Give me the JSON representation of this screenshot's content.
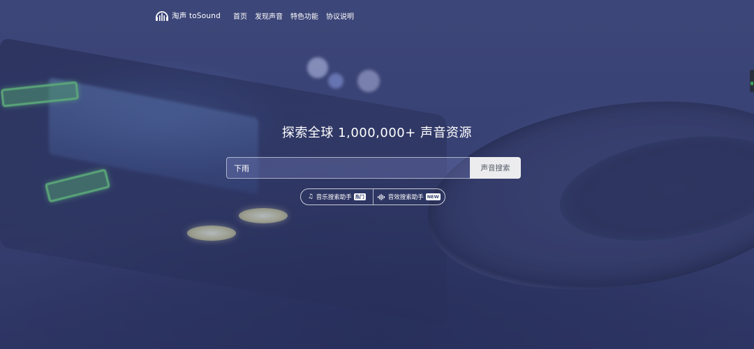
{
  "header": {
    "logo_text": "淘声 toSound",
    "nav": [
      {
        "label": "首页"
      },
      {
        "label": "发现声音"
      },
      {
        "label": "特色功能"
      },
      {
        "label": "协议说明"
      }
    ]
  },
  "hero": {
    "title": "探索全球 1,000,000+ 声音资源"
  },
  "search": {
    "value": "下雨",
    "button_label": "声音搜索"
  },
  "assistants": [
    {
      "icon": "music-note-icon",
      "label": "音乐搜索助手",
      "badge": "热门"
    },
    {
      "icon": "sound-wave-icon",
      "label": "音效搜索助手",
      "badge": "NEW"
    }
  ],
  "colors": {
    "background": "#37406a",
    "search_button_bg": "#ececef",
    "text": "#ffffff"
  }
}
